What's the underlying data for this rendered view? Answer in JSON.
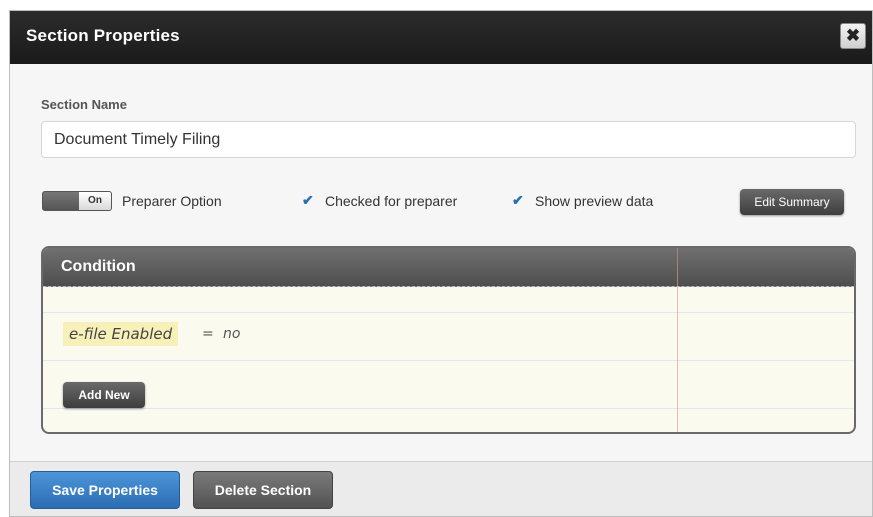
{
  "dialog": {
    "title": "Section Properties",
    "close_glyph": "✖"
  },
  "section_name": {
    "label": "Section Name",
    "value": "Document Timely Filing"
  },
  "options": {
    "toggle_state": "On",
    "preparer_option_label": "Preparer Option",
    "checked_for_preparer_label": "Checked for preparer",
    "checked_for_preparer": true,
    "show_preview_label": "Show preview data",
    "show_preview": true,
    "check_glyph": "✔",
    "edit_summary_label": "Edit Summary"
  },
  "condition": {
    "title": "Condition",
    "rule": {
      "field": "e-file Enabled",
      "operator": "=",
      "value": "no"
    },
    "add_new_label": "Add New"
  },
  "footer": {
    "save_label": "Save Properties",
    "delete_label": "Delete Section"
  },
  "colors": {
    "accent_blue": "#2b6db3",
    "titlebar": "#1f1f1f",
    "condition_bg": "#fbfaee",
    "chip": "#f7f0b8"
  }
}
